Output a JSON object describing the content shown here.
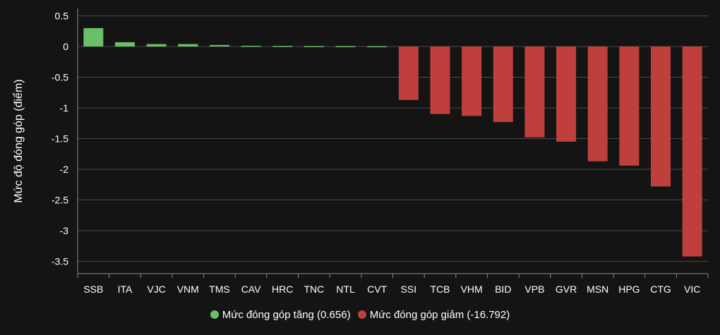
{
  "chart_data": {
    "type": "bar",
    "ylabel": "Mức độ đóng góp (điểm)",
    "ylim": [
      -3.7,
      0.62
    ],
    "yticks": [
      "0.5",
      "0",
      "-0.5",
      "-1",
      "-1.5",
      "-2",
      "-2.5",
      "-3",
      "-3.5"
    ],
    "grid": true,
    "legend_position": "bottom",
    "categories": [
      "SSB",
      "ITA",
      "VJC",
      "VNM",
      "TMS",
      "CAV",
      "HRC",
      "TNC",
      "NTL",
      "CVT",
      "SSI",
      "TCB",
      "VHM",
      "BID",
      "VPB",
      "GVR",
      "MSN",
      "HPG",
      "CTG",
      "VIC"
    ],
    "values": [
      0.3,
      0.07,
      0.04,
      0.04,
      0.025,
      0.012,
      0.01,
      0.008,
      0.007,
      0.005,
      -0.87,
      -1.1,
      -1.13,
      -1.23,
      -1.48,
      -1.55,
      -1.87,
      -1.94,
      -2.28,
      -3.42
    ],
    "series": [
      {
        "name": "Mức đóng góp tăng (0.656)",
        "color": "#6abf69"
      },
      {
        "name": "Mức đóng góp giảm (-16.792)",
        "color": "#bf3f3d"
      }
    ]
  },
  "colors": {
    "background": "#141415",
    "grid": "#4a4a4a",
    "axis": "#8a8a8a"
  }
}
